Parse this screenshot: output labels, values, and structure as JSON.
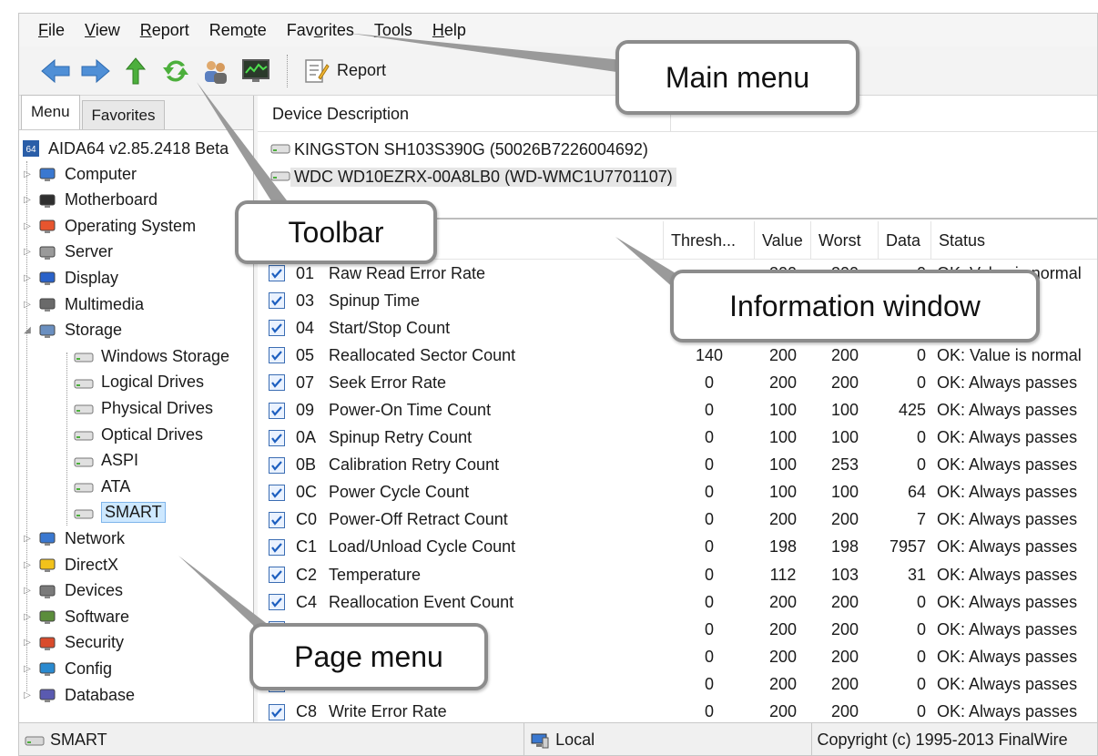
{
  "menubar": [
    {
      "label": "File",
      "u": "F",
      "rest": "ile"
    },
    {
      "label": "View",
      "u": "V",
      "rest": "iew"
    },
    {
      "label": "Report",
      "u": "R",
      "rest": "eport"
    },
    {
      "label": "Remote",
      "pre": "Rem",
      "u": "o",
      "rest": "te"
    },
    {
      "label": "Favorites",
      "pre": "Fav",
      "u": "o",
      "rest": "rites"
    },
    {
      "label": "Tools",
      "u": "T",
      "rest": "ools"
    },
    {
      "label": "Help",
      "u": "H",
      "rest": "elp"
    }
  ],
  "toolbar": {
    "icons": [
      "back-arrow-icon",
      "forward-arrow-icon",
      "up-arrow-icon",
      "refresh-icon",
      "users-icon",
      "monitor-icon"
    ],
    "report_label": "Report"
  },
  "left_tabs": [
    "Menu",
    "Favorites"
  ],
  "tree": {
    "root": "AIDA64 v2.85.2418 Beta",
    "items": [
      {
        "label": "Computer",
        "icon": "computer-icon"
      },
      {
        "label": "Motherboard",
        "icon": "motherboard-icon"
      },
      {
        "label": "Operating System",
        "icon": "windows-icon"
      },
      {
        "label": "Server",
        "icon": "server-icon"
      },
      {
        "label": "Display",
        "icon": "display-icon"
      },
      {
        "label": "Multimedia",
        "icon": "speaker-icon"
      },
      {
        "label": "Storage",
        "icon": "storage-icon"
      },
      {
        "label": "Network",
        "icon": "network-icon"
      },
      {
        "label": "DirectX",
        "icon": "directx-icon"
      },
      {
        "label": "Devices",
        "icon": "devices-icon"
      },
      {
        "label": "Software",
        "icon": "software-icon"
      },
      {
        "label": "Security",
        "icon": "security-icon"
      },
      {
        "label": "Config",
        "icon": "config-icon"
      },
      {
        "label": "Database",
        "icon": "database-icon"
      }
    ],
    "storage_children": [
      "Windows Storage",
      "Logical Drives",
      "Physical Drives",
      "Optical Drives",
      "ASPI",
      "ATA",
      "SMART"
    ]
  },
  "device_header": "Device Description",
  "devices": [
    "KINGSTON SH103S390G (50026B7226004692)",
    "WDC WD10EZRX-00A8LB0 (WD-WMC1U7701107)"
  ],
  "smart_columns": [
    "ription",
    "Thresh...",
    "Value",
    "Worst",
    "Data",
    "Status"
  ],
  "smart_rows": [
    {
      "id": "01",
      "desc": "Raw Read Error Rate",
      "th": "",
      "val": "200",
      "worst": "200",
      "data": "0",
      "status": "OK: Value is normal"
    },
    {
      "id": "03",
      "desc": "Spinup Time",
      "th": "",
      "val": "",
      "worst": "",
      "data": "",
      "status": "ormal"
    },
    {
      "id": "04",
      "desc": "Start/Stop Count",
      "th": "",
      "val": "",
      "worst": "",
      "data": "",
      "status": "asses"
    },
    {
      "id": "05",
      "desc": "Reallocated Sector Count",
      "th": "140",
      "val": "200",
      "worst": "200",
      "data": "0",
      "status": "OK: Value is normal"
    },
    {
      "id": "07",
      "desc": "Seek Error Rate",
      "th": "0",
      "val": "200",
      "worst": "200",
      "data": "0",
      "status": "OK: Always passes"
    },
    {
      "id": "09",
      "desc": "Power-On Time Count",
      "th": "0",
      "val": "100",
      "worst": "100",
      "data": "425",
      "status": "OK: Always passes"
    },
    {
      "id": "0A",
      "desc": "Spinup Retry Count",
      "th": "0",
      "val": "100",
      "worst": "100",
      "data": "0",
      "status": "OK: Always passes"
    },
    {
      "id": "0B",
      "desc": "Calibration Retry Count",
      "th": "0",
      "val": "100",
      "worst": "253",
      "data": "0",
      "status": "OK: Always passes"
    },
    {
      "id": "0C",
      "desc": "Power Cycle Count",
      "th": "0",
      "val": "100",
      "worst": "100",
      "data": "64",
      "status": "OK: Always passes"
    },
    {
      "id": "C0",
      "desc": "Power-Off Retract Count",
      "th": "0",
      "val": "200",
      "worst": "200",
      "data": "7",
      "status": "OK: Always passes"
    },
    {
      "id": "C1",
      "desc": "Load/Unload Cycle Count",
      "th": "0",
      "val": "198",
      "worst": "198",
      "data": "7957",
      "status": "OK: Always passes"
    },
    {
      "id": "C2",
      "desc": "Temperature",
      "th": "0",
      "val": "112",
      "worst": "103",
      "data": "31",
      "status": "OK: Always passes"
    },
    {
      "id": "C4",
      "desc": "Reallocation Event Count",
      "th": "0",
      "val": "200",
      "worst": "200",
      "data": "0",
      "status": "OK: Always passes"
    },
    {
      "id": "",
      "desc": "tor Count",
      "th": "0",
      "val": "200",
      "worst": "200",
      "data": "0",
      "status": "OK: Always passes"
    },
    {
      "id": "",
      "desc": "Sector Count",
      "th": "0",
      "val": "200",
      "worst": "200",
      "data": "0",
      "status": "OK: Always passes"
    },
    {
      "id": "",
      "desc": "ate",
      "th": "0",
      "val": "200",
      "worst": "200",
      "data": "0",
      "status": "OK: Always passes"
    },
    {
      "id": "C8",
      "desc": "Write Error Rate",
      "th": "0",
      "val": "200",
      "worst": "200",
      "data": "0",
      "status": "OK: Always passes"
    }
  ],
  "statusbar": {
    "left": "SMART",
    "middle": "Local",
    "right": "Copyright (c) 1995-2013 FinalWire"
  },
  "callouts": {
    "main_menu": "Main menu",
    "toolbar": "Toolbar",
    "information_window": "Information window",
    "page_menu": "Page menu"
  }
}
